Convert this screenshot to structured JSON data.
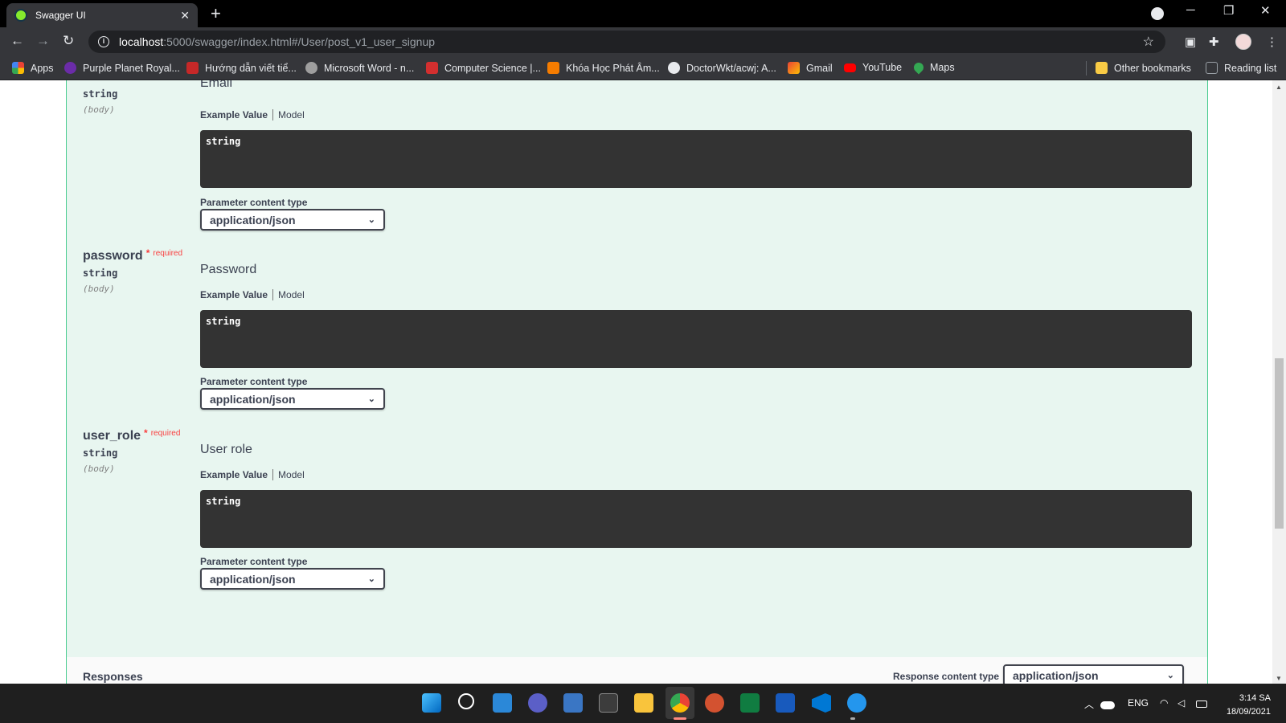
{
  "browser": {
    "tab_title": "Swagger UI",
    "tab_close": "✕",
    "new_tab": "+",
    "url_host": "localhost",
    "url_rest": ":5000/swagger/index.html#/User/post_v1_user_signup"
  },
  "bookmarks": [
    {
      "label": "Apps",
      "color": "#f4b400"
    },
    {
      "label": "Purple Planet Royal...",
      "color": "#6b2ca8"
    },
    {
      "label": "Hướng dẫn viết tiể...",
      "color": "#c62828"
    },
    {
      "label": "Microsoft Word - n...",
      "color": "#9e9e9e"
    },
    {
      "label": "Computer Science |...",
      "color": "#d32f2f"
    },
    {
      "label": "Khóa Học Phát Âm...",
      "color": "#f57c00"
    },
    {
      "label": "DoctorWkt/acwj: A...",
      "color": "#e8eaed"
    },
    {
      "label": "Gmail",
      "color": "#ea4335"
    },
    {
      "label": "YouTube",
      "color": "#ff0000"
    },
    {
      "label": "Maps",
      "color": "#34a853"
    },
    {
      "label": "Other bookmarks",
      "color": "#f9cb45"
    },
    {
      "label": "Reading list",
      "color": "#9aa0a6"
    }
  ],
  "params": {
    "email": {
      "type": "string",
      "in": "(body)",
      "description": "Email",
      "example_tab": "Example Value",
      "model_tab": "Model",
      "example": "string",
      "content_type_label": "Parameter content type",
      "content_type": "application/json"
    },
    "password": {
      "name": "password",
      "required_star": "*",
      "required_text": "required",
      "type": "string",
      "in": "(body)",
      "description": "Password",
      "example_tab": "Example Value",
      "model_tab": "Model",
      "example": "string",
      "content_type_label": "Parameter content type",
      "content_type": "application/json"
    },
    "user_role": {
      "name": "user_role",
      "required_star": "*",
      "required_text": "required",
      "type": "string",
      "in": "(body)",
      "description": "User role",
      "example_tab": "Example Value",
      "model_tab": "Model",
      "example": "string",
      "content_type_label": "Parameter content type",
      "content_type": "application/json"
    }
  },
  "responses": {
    "title": "Responses",
    "content_type_label": "Response content type",
    "content_type": "application/json"
  },
  "tray": {
    "lang": "ENG",
    "time": "3:14 SA",
    "date": "18/09/2021"
  },
  "colors": {
    "post_green": "#49cc90",
    "post_bg": "#e8f6f0",
    "required_red": "#f93e3e",
    "code_bg": "#333333"
  }
}
